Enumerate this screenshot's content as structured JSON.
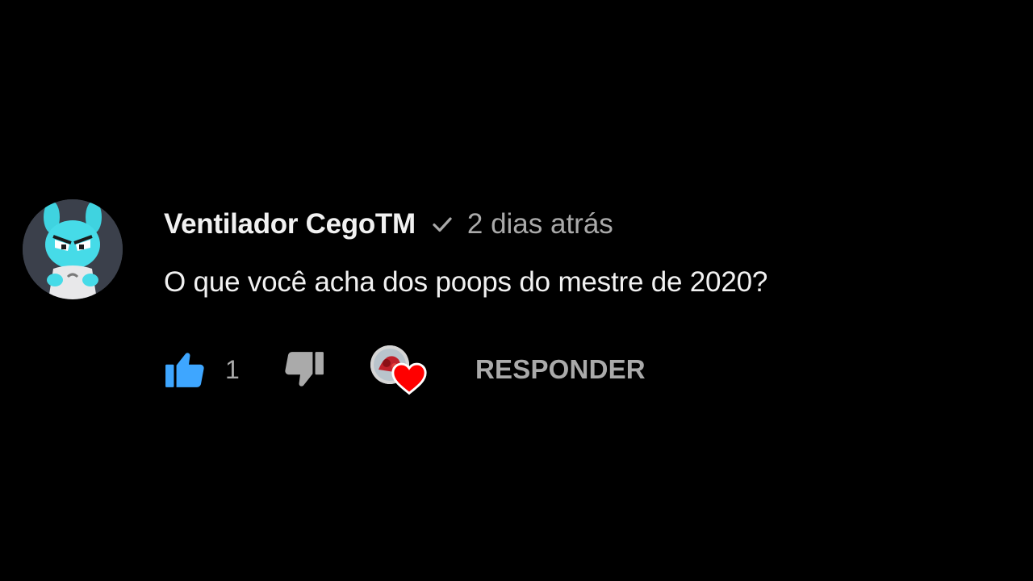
{
  "comment": {
    "author": "Ventilador CegoTM",
    "verified_icon": "checkmark-icon",
    "timestamp": "2 dias atrás",
    "text": "O que você acha dos poops do mestre de 2020?",
    "like_count": "1",
    "reply_label": "RESPONDER",
    "hearted_by_creator": true
  },
  "icons": {
    "like": "thumbs-up-icon",
    "dislike": "thumbs-down-icon",
    "heart": "heart-icon"
  },
  "colors": {
    "background": "#000000",
    "like_active": "#3ea6ff",
    "heart": "#ff0000",
    "secondary_text": "#aaaaaa"
  }
}
